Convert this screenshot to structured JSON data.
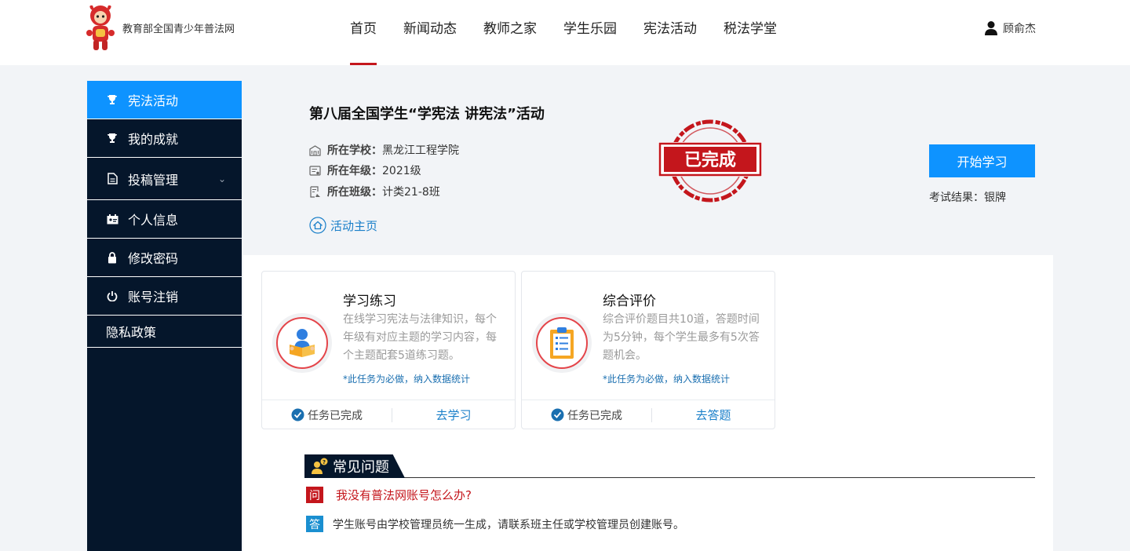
{
  "header": {
    "logo_text": "教育部全国青少年普法网",
    "nav": [
      "首页",
      "新闻动态",
      "教师之家",
      "学生乐园",
      "宪法活动",
      "税法学堂"
    ],
    "active_nav": "首页",
    "user_name": "顾俞杰"
  },
  "sidebar": {
    "items": [
      {
        "label": "宪法活动",
        "icon": "trophy-icon"
      },
      {
        "label": "我的成就",
        "icon": "trophy-icon"
      },
      {
        "label": "投稿管理",
        "icon": "document-icon"
      },
      {
        "label": "个人信息",
        "icon": "id-card-icon"
      },
      {
        "label": "修改密码",
        "icon": "lock-icon"
      },
      {
        "label": "账号注销",
        "icon": "power-icon"
      },
      {
        "label": "隐私政策"
      }
    ]
  },
  "activity": {
    "title": "第八届全国学生“学宪法 讲宪法”活动",
    "school_label": "所在学校：",
    "school": "黑龙江工程学院",
    "grade_label": "所在年级：",
    "grade": "2021级",
    "class_label": "所在班级：",
    "class": "计类21-8班",
    "home_link": "活动主页",
    "stamp_text": "已完成",
    "start_button": "开始学习",
    "exam_result": "考试结果：银牌"
  },
  "cards": [
    {
      "title": "学习练习",
      "desc": "在线学习宪法与法律知识，每个年级有对应主题的学习内容，每个主题配套5道练习题。",
      "note": "*此任务为必做，纳入数据统计",
      "status": "任务已完成",
      "action": "去学习",
      "icon": "reading-student-icon"
    },
    {
      "title": "综合评价",
      "desc": "综合评价题目共10道，答题时间为5分钟，每个学生最多有5次答题机会。",
      "note": "*此任务为必做，纳入数据统计",
      "status": "任务已完成",
      "action": "去答题",
      "icon": "clipboard-icon"
    }
  ],
  "faq": {
    "title": "常见问题",
    "q_badge": "问",
    "a_badge": "答",
    "question": "我没有普法网账号怎么办?",
    "answer": "学生账号由学校管理员统一生成，请联系班主任或学校管理员创建账号。"
  },
  "colors": {
    "brand_red": "#c4161c",
    "accent_blue": "#0e93ff",
    "sidebar_bg": "#05162b"
  }
}
